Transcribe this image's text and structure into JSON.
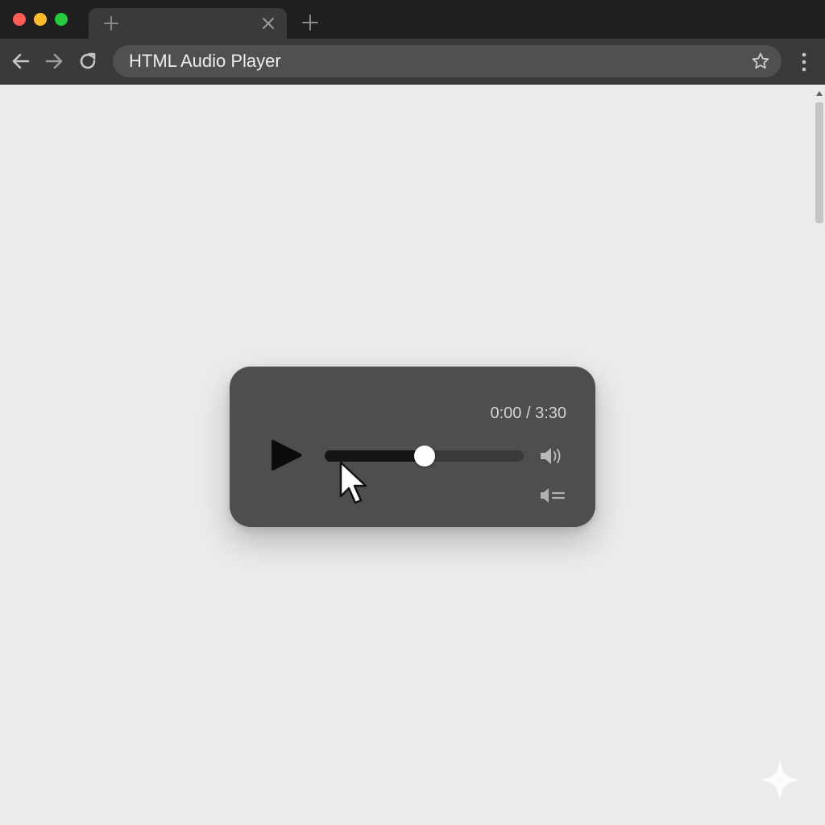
{
  "browser": {
    "address_text": "HTML Audio Player"
  },
  "player": {
    "time": "0:00 / 3:30",
    "progress_fraction": 0.5
  },
  "icons": {
    "traffic_close": "window-close-dot",
    "traffic_minimize": "window-minimize-dot",
    "traffic_zoom": "window-zoom-dot",
    "tab_plus": "plus-icon",
    "tab_close": "close-icon",
    "new_tab": "plus-icon",
    "back": "arrow-left-icon",
    "forward": "arrow-right-icon",
    "reload": "reload-icon",
    "bookmark": "star-icon",
    "menu": "kebab-menu-icon",
    "play": "play-icon",
    "volume": "speaker-icon",
    "volume_settings": "speaker-settings-icon",
    "cursor": "mouse-pointer-icon",
    "watermark": "sparkle-icon"
  },
  "colors": {
    "tabstrip_bg": "#1f1f1f",
    "toolbar_bg": "#3a3a3a",
    "omnibox_bg": "#505050",
    "page_bg": "#ebebeb",
    "player_bg": "#4e4e4e",
    "progress_fill": "#141414",
    "progress_track": "#3a3a3a",
    "traffic_red": "#ff5f57",
    "traffic_yellow": "#febc2e",
    "traffic_green": "#28c840"
  }
}
